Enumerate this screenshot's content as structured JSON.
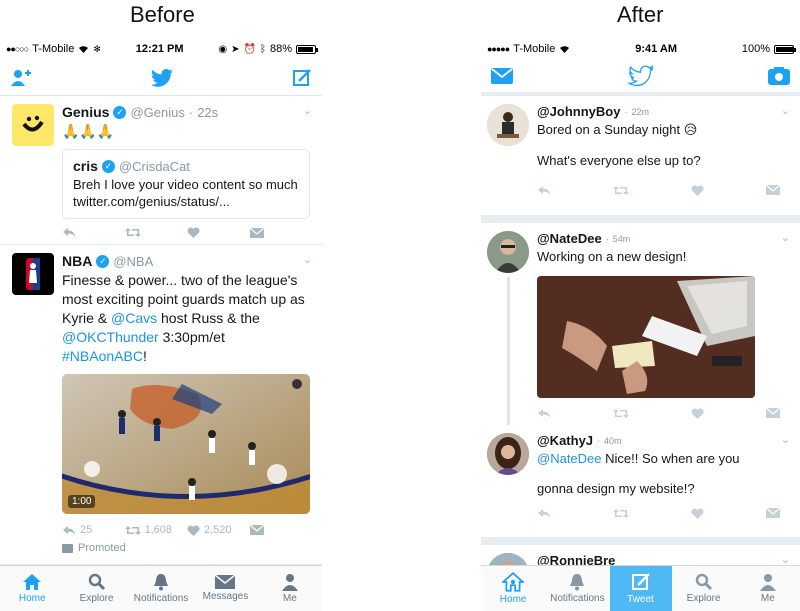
{
  "headings": {
    "before": "Before",
    "after": "After"
  },
  "left": {
    "status": {
      "carrier": "T-Mobile",
      "time": "12:21 PM",
      "battery": "88%"
    },
    "tweets": [
      {
        "name": "Genius",
        "handle": "@Genius",
        "time": "22s",
        "text": "🙏🙏🙏",
        "quote": {
          "name": "cris",
          "handle": "@CrisdaCat",
          "text": "Breh I love your video content so much twitter.com/genius/status/..."
        }
      },
      {
        "name": "NBA",
        "handle": "@NBA",
        "text_a": "Finesse & power... two of the league's most exciting point guards match up as Kyrie & ",
        "link_a": "@Cavs",
        "text_b": " host Russ & the ",
        "link_b": "@OKCThunder",
        "text_c": " 3:30pm/et ",
        "link_c": "#NBAonABC",
        "text_d": "!",
        "video_time": "1:00",
        "retweets_reply": "25",
        "retweets": "1,608",
        "likes": "2,520",
        "promoted": "Promoted"
      }
    ],
    "tabs": [
      "Home",
      "Explore",
      "Notifications",
      "Messages",
      "Me"
    ]
  },
  "right": {
    "status": {
      "carrier": "T-Mobile",
      "time": "9:41 AM",
      "battery": "100%"
    },
    "tweets": [
      {
        "name": "@JohnnyBoy",
        "time": "22m",
        "line1": "Bored on a Sunday night 😥",
        "line2": "What's everyone else up to?"
      },
      {
        "name": "@NateDee",
        "time": "54m",
        "line1": "Working on a new design!"
      },
      {
        "name": "@KathyJ",
        "time": "40m",
        "mention": "@NateDee",
        "line1": " Nice!! So when are you",
        "line2": "gonna design my website!?"
      },
      {
        "name": "@RonnieBre",
        "time": ""
      }
    ],
    "tabs": [
      "Home",
      "Notifications",
      "Tweet",
      "Explore",
      "Me"
    ]
  },
  "colors": {
    "twitter_blue": "#1da1f2",
    "grey": "#aab8c2"
  }
}
